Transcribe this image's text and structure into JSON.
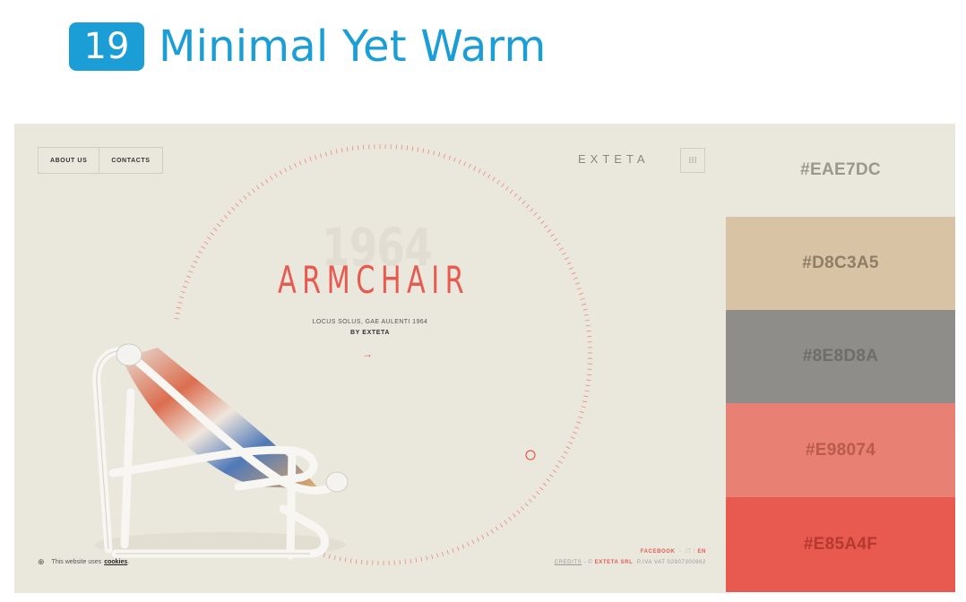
{
  "heading": {
    "number": "19",
    "title": "Minimal Yet Warm"
  },
  "site": {
    "nav": [
      "ABOUT US",
      "CONTACTS"
    ],
    "brand": "EXTETA",
    "year": "1964",
    "title": "ARMCHAIR",
    "subtitle": "LOCUS SOLUS, GAE AULENTI 1964",
    "byline": "BY EXTETA",
    "arrow": "→",
    "cookie_text": "This website uses",
    "cookie_link": "cookies",
    "cookie_end": ".",
    "footer": {
      "facebook": "FACEBOOK",
      "sep": "-",
      "lang_it": "IT /",
      "lang_en": "EN",
      "credits": "CREDITS",
      "copyright": "- ©",
      "company": "EXTETA SRL",
      "vat": "P.IVA VAT 02907300962"
    }
  },
  "palette": [
    {
      "hex": "#EAE7DC",
      "label": "#EAE7DC",
      "text_color": "#9a978e"
    },
    {
      "hex": "#D8C3A5",
      "label": "#D8C3A5",
      "text_color": "#8f7e66"
    },
    {
      "hex": "#8E8D8A",
      "label": "#8E8D8A",
      "text_color": "#6e6d6a"
    },
    {
      "hex": "#E98074",
      "label": "#E98074",
      "text_color": "#b95a4f"
    },
    {
      "hex": "#E85A4F",
      "label": "#E85A4F",
      "text_color": "#b5392f"
    }
  ],
  "colors": {
    "accent": "#1b9ed6",
    "dial": "#E85A4F",
    "background": "#EAE7DC"
  }
}
